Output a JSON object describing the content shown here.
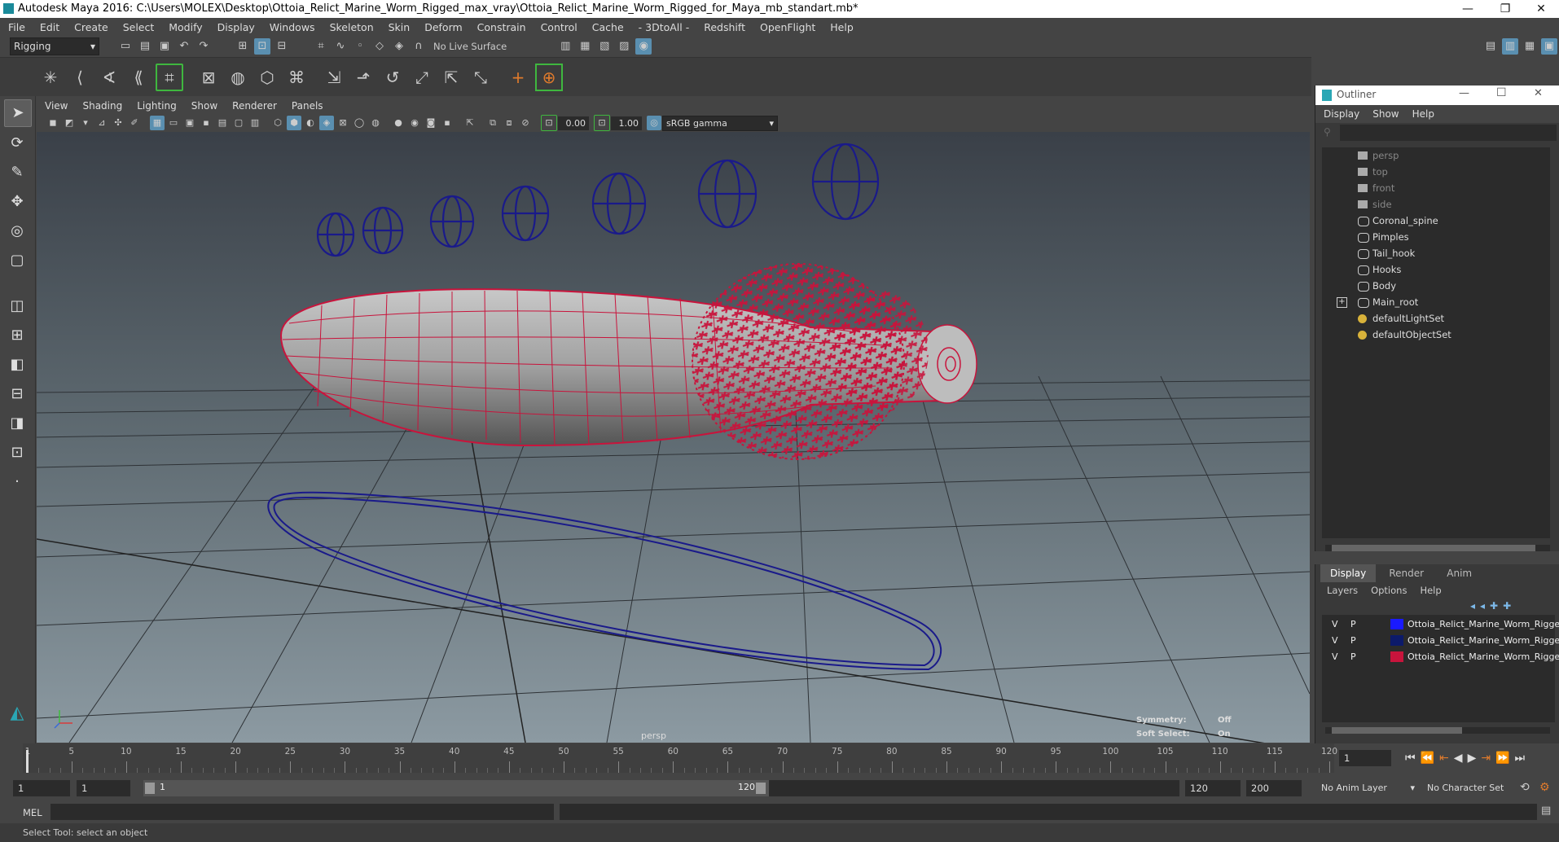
{
  "window": {
    "title": "Autodesk Maya 2016: C:\\Users\\MOLEX\\Desktop\\Ottoia_Relict_Marine_Worm_Rigged_max_vray\\Ottoia_Relict_Marine_Worm_Rigged_for_Maya_mb_standart.mb*",
    "minimize": "—",
    "restore": "❐",
    "close": "✕"
  },
  "menubar": [
    "File",
    "Edit",
    "Create",
    "Select",
    "Modify",
    "Display",
    "Windows",
    "Skeleton",
    "Skin",
    "Deform",
    "Constrain",
    "Control",
    "Cache",
    "- 3DtoAll -",
    "Redshift",
    "OpenFlight",
    "Help"
  ],
  "statusline": {
    "mode": "Rigging",
    "live_surface": "No Live Surface"
  },
  "viewport": {
    "menu": [
      "View",
      "Shading",
      "Lighting",
      "Show",
      "Renderer",
      "Panels"
    ],
    "near_value": "0.00",
    "far_value": "1.00",
    "color_space": "sRGB gamma",
    "camera_label": "persp",
    "hud": {
      "symmetry_label": "Symmetry:",
      "symmetry_value": "Off",
      "soft_select_label": "Soft Select:",
      "soft_select_value": "On"
    }
  },
  "outliner": {
    "title": "Outliner",
    "menu": [
      "Display",
      "Show",
      "Help"
    ],
    "items": [
      {
        "label": "persp",
        "icon": "camera-icon",
        "dim": true
      },
      {
        "label": "top",
        "icon": "camera-icon",
        "dim": true
      },
      {
        "label": "front",
        "icon": "camera-icon",
        "dim": true
      },
      {
        "label": "side",
        "icon": "camera-icon",
        "dim": true
      },
      {
        "label": "Coronal_spine",
        "icon": "transform-icon",
        "dim": false
      },
      {
        "label": "Pimples",
        "icon": "transform-icon",
        "dim": false
      },
      {
        "label": "Tail_hook",
        "icon": "transform-icon",
        "dim": false
      },
      {
        "label": "Hooks",
        "icon": "transform-icon",
        "dim": false
      },
      {
        "label": "Body",
        "icon": "transform-icon",
        "dim": false
      },
      {
        "label": "Main_root",
        "icon": "transform-icon",
        "dim": false,
        "expandable": true
      },
      {
        "label": "defaultLightSet",
        "icon": "set-icon",
        "dim": false
      },
      {
        "label": "defaultObjectSet",
        "icon": "set-icon",
        "dim": false
      }
    ]
  },
  "layers": {
    "tabs": [
      "Display",
      "Render",
      "Anim"
    ],
    "menu": [
      "Layers",
      "Options",
      "Help"
    ],
    "rows": [
      {
        "v": "V",
        "p": "P",
        "color": "#1a1aff",
        "name": "Ottoia_Relict_Marine_Worm_Rigged"
      },
      {
        "v": "V",
        "p": "P",
        "color": "#0c1a6a",
        "name": "Ottoia_Relict_Marine_Worm_Rigged"
      },
      {
        "v": "V",
        "p": "P",
        "color": "#c8143c",
        "name": "Ottoia_Relict_Marine_Worm_Rigged"
      }
    ]
  },
  "timeline": {
    "ticks": [
      1,
      5,
      10,
      15,
      20,
      25,
      30,
      35,
      40,
      45,
      50,
      55,
      60,
      65,
      70,
      75,
      80,
      85,
      90,
      95,
      100,
      105,
      110,
      115,
      120
    ],
    "current_frame": "1"
  },
  "range": {
    "start": "1",
    "playback_start": "1",
    "slider_start": "1",
    "slider_end": "120",
    "playback_end": "120",
    "end": "200",
    "anim_layer": "No Anim Layer",
    "character_set": "No Character Set"
  },
  "command": {
    "language": "MEL"
  },
  "help_line": "Select Tool: select an object",
  "colors": {
    "mesh_wire": "#c8143c",
    "control_curve": "#1a1a8a",
    "viewport_top": "#3a4048",
    "viewport_bottom": "#8c9aa2",
    "accent": "#5a8fb0"
  }
}
